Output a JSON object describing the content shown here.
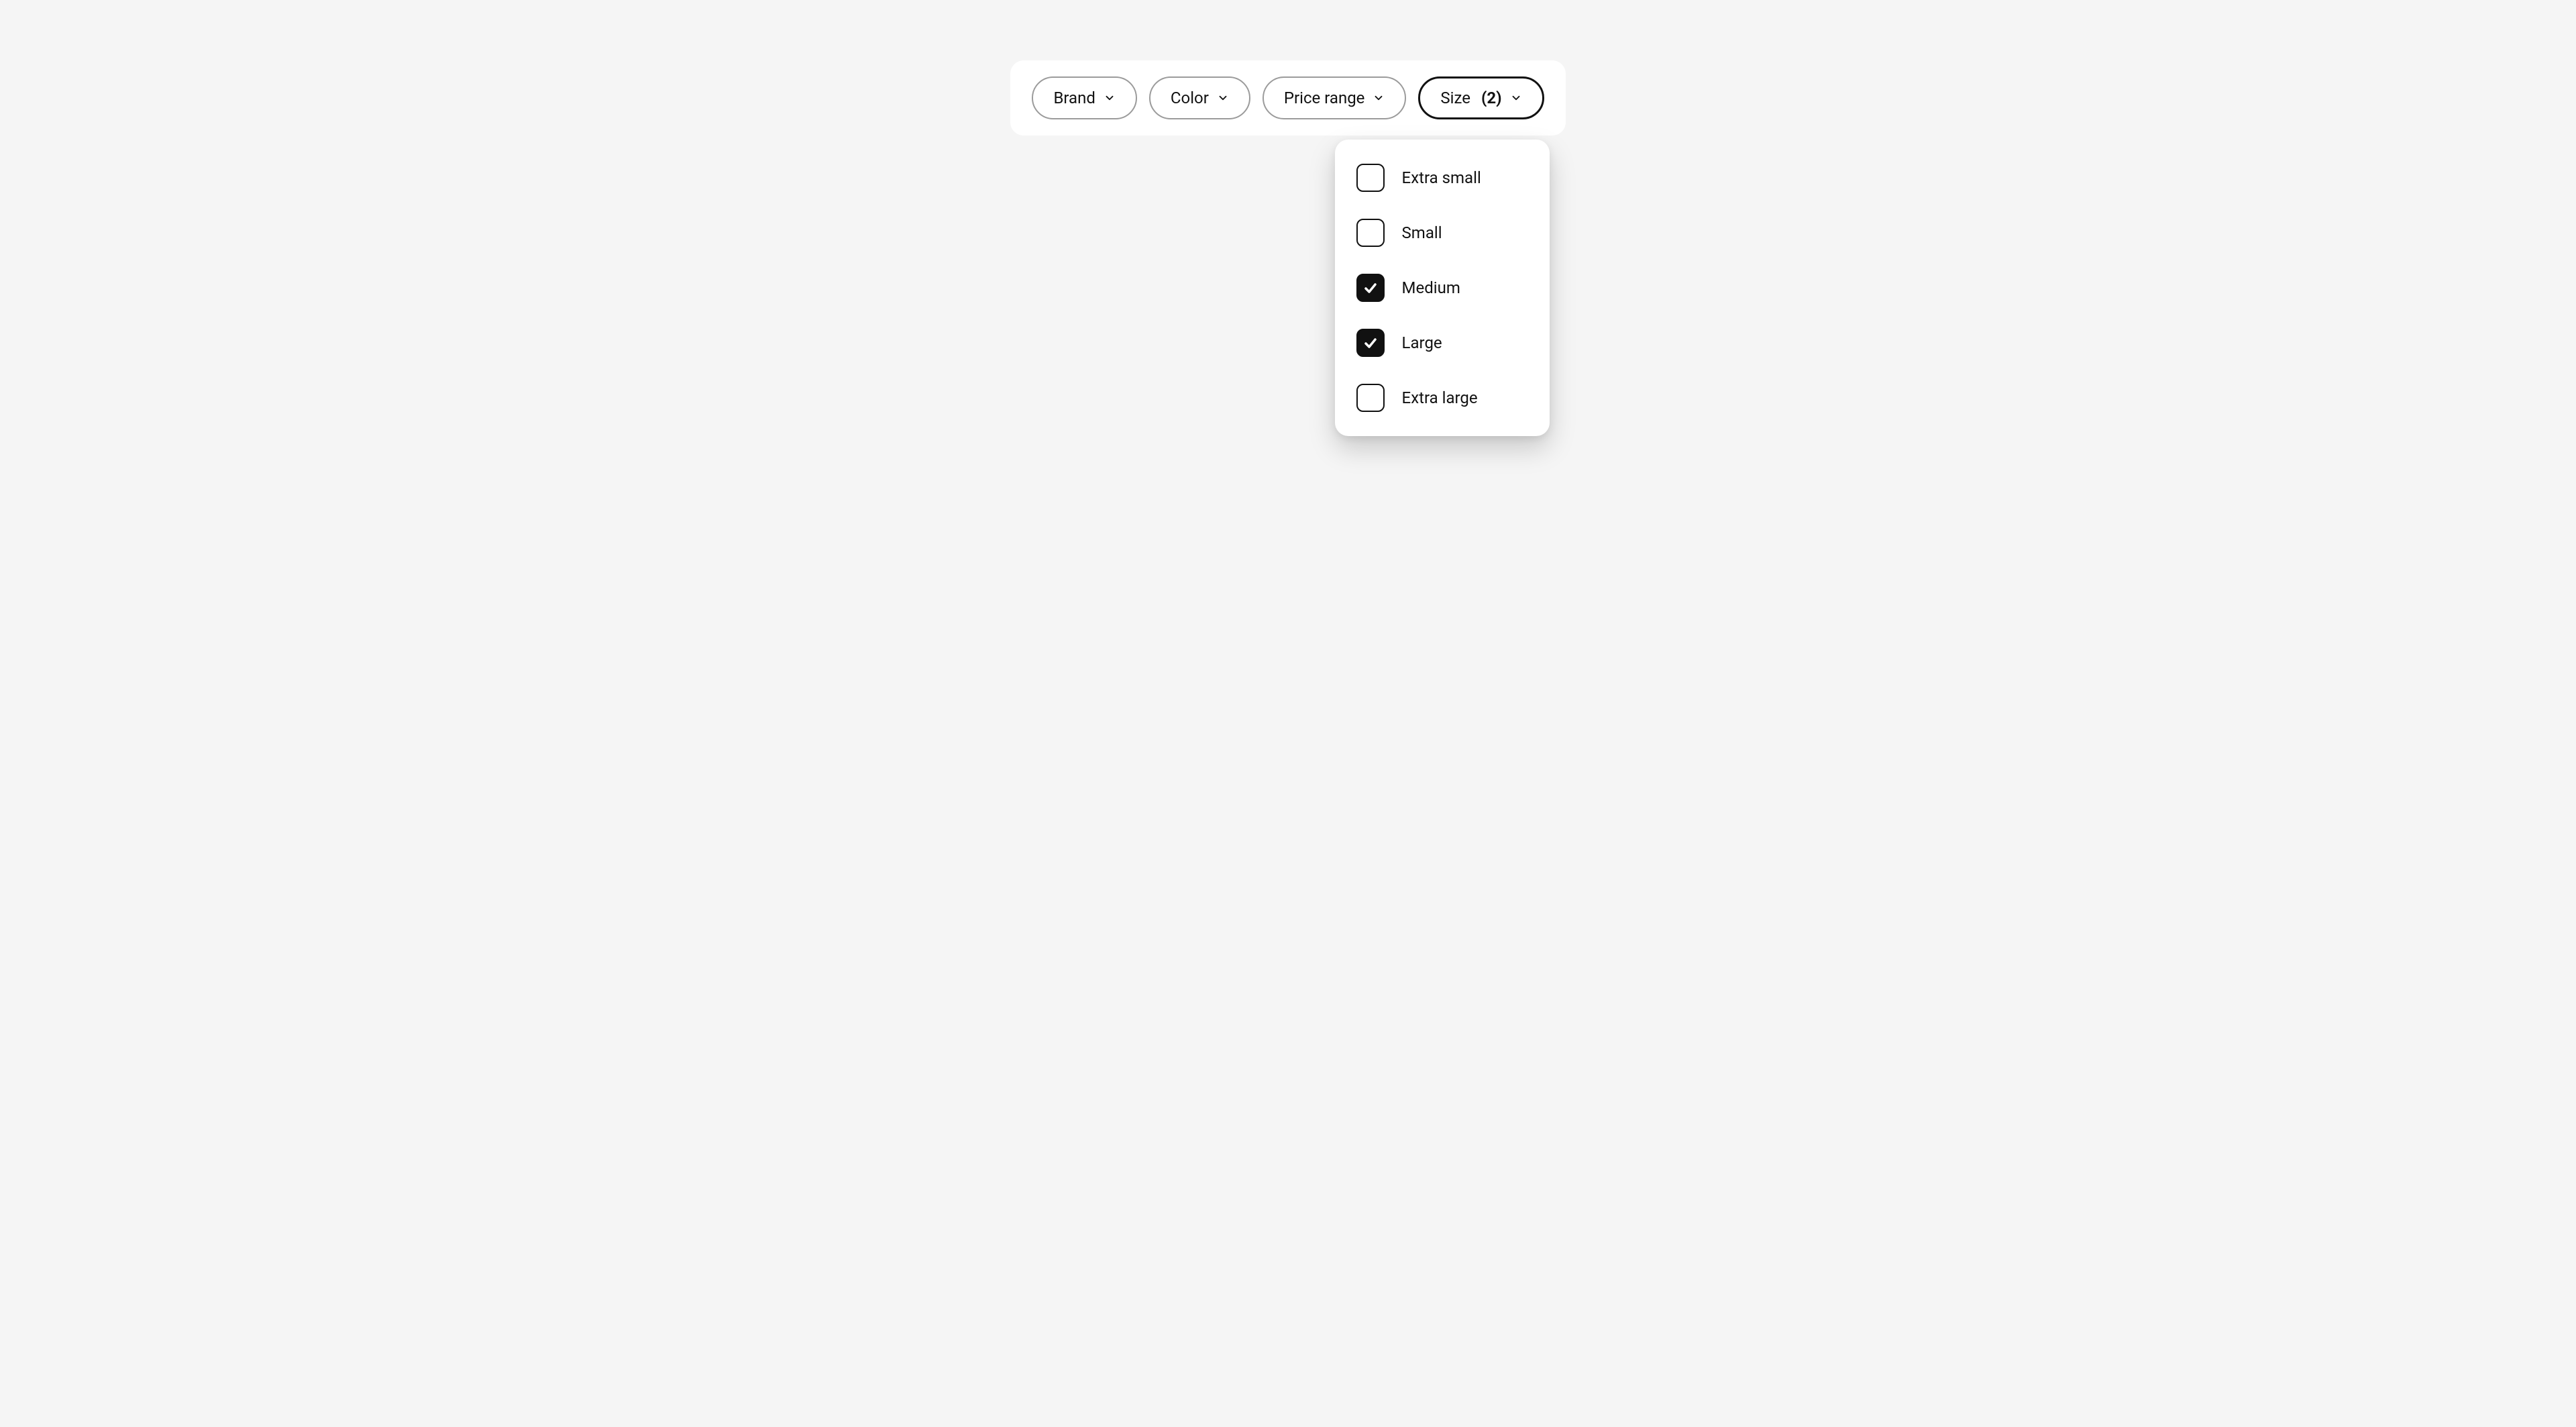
{
  "filters": [
    {
      "label": "Brand",
      "count": null,
      "active": false
    },
    {
      "label": "Color",
      "count": null,
      "active": false
    },
    {
      "label": "Price range",
      "count": null,
      "active": false
    },
    {
      "label": "Size",
      "count": 2,
      "active": true
    }
  ],
  "dropdown": {
    "options": [
      {
        "label": "Extra small",
        "checked": false
      },
      {
        "label": "Small",
        "checked": false
      },
      {
        "label": "Medium",
        "checked": true
      },
      {
        "label": "Large",
        "checked": true
      },
      {
        "label": "Extra large",
        "checked": false
      }
    ]
  }
}
